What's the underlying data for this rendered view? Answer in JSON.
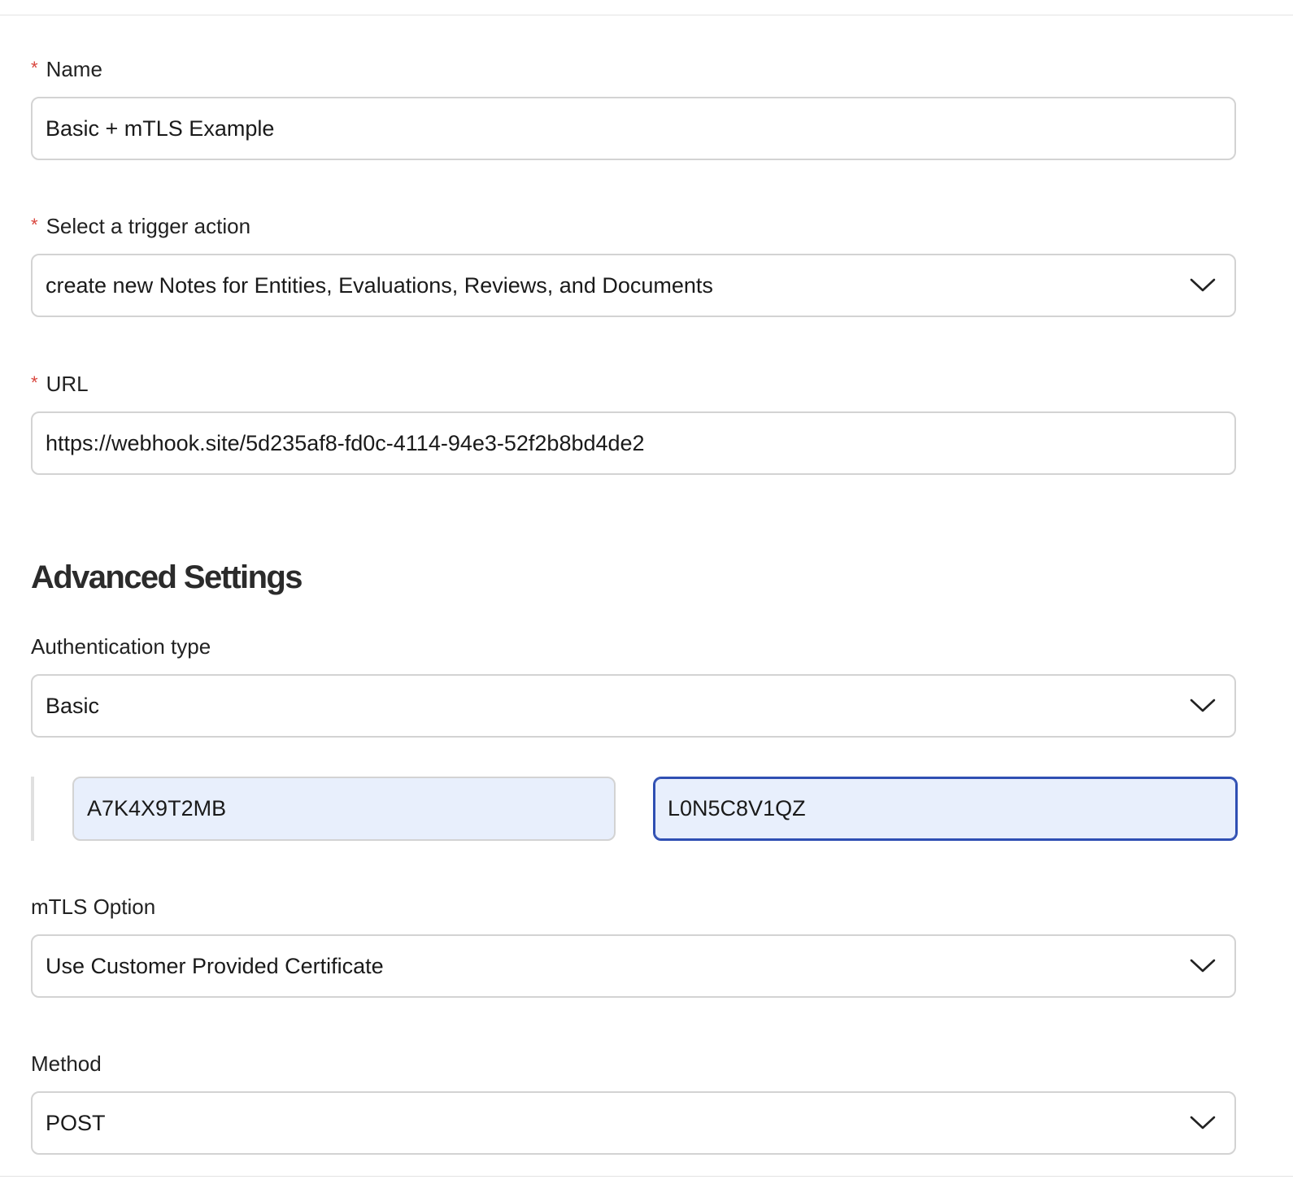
{
  "name": {
    "label": "Name",
    "required_marker": "*",
    "value": "Basic + mTLS Example"
  },
  "trigger": {
    "label": "Select a trigger action",
    "required_marker": "*",
    "value": "create new Notes for Entities, Evaluations, Reviews, and Documents"
  },
  "url": {
    "label": "URL",
    "required_marker": "*",
    "value": "https://webhook.site/5d235af8-fd0c-4114-94e3-52f2b8bd4de2"
  },
  "advanced": {
    "title": "Advanced Settings"
  },
  "auth": {
    "label": "Authentication type",
    "value": "Basic",
    "username_value": "A7K4X9T2MB",
    "password_value": "L0N5C8V1QZ"
  },
  "mtls": {
    "label": "mTLS Option",
    "value": "Use Customer Provided Certificate"
  },
  "method": {
    "label": "Method",
    "value": "POST"
  },
  "colors": {
    "required": "#d9453d",
    "focus_border": "#2f4fb3",
    "autofill_bg": "#e8effc",
    "field_border": "#d3d3d3"
  },
  "icons": {
    "select_toggle": "chevron-down-icon"
  }
}
